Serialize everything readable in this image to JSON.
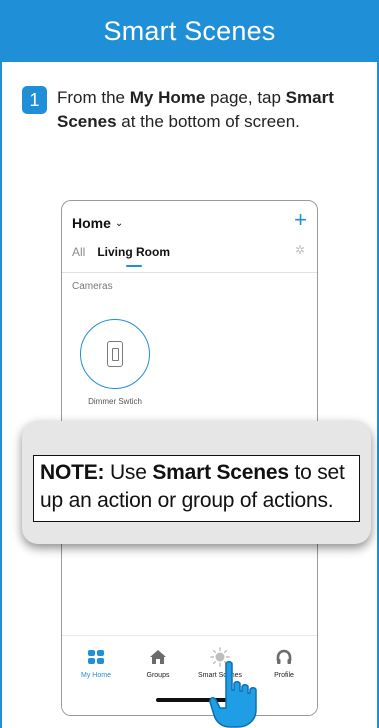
{
  "header": {
    "title": "Smart Scenes"
  },
  "step": {
    "number": "1",
    "text_1": "From the ",
    "bold_1": "My Home",
    "text_2": " page, tap ",
    "bold_2": "Smart Scenes",
    "text_3": " at the bottom of screen."
  },
  "phone": {
    "home_label": "Home",
    "home_chevron": "⌄",
    "add_glyph": "+",
    "tabs": {
      "all": "All",
      "room": "Living Room"
    },
    "gear_glyph": "✲",
    "section": "Cameras",
    "device": {
      "label": "Dimmer Swtich",
      "icon": "switch-icon"
    },
    "nav": [
      {
        "label": "My Home",
        "icon": "grid-icon"
      },
      {
        "label": "Groups",
        "icon": "house-icon"
      },
      {
        "label": "Smart Scenes",
        "icon": "sun-icon"
      },
      {
        "label": "Profile",
        "icon": "headset-icon"
      }
    ]
  },
  "note": {
    "label": "NOTE:",
    "text_1": " Use ",
    "bold": "Smart Scenes",
    "text_2": " to set up an action or group of actions."
  },
  "colors": {
    "accent": "#1f8fd8"
  }
}
